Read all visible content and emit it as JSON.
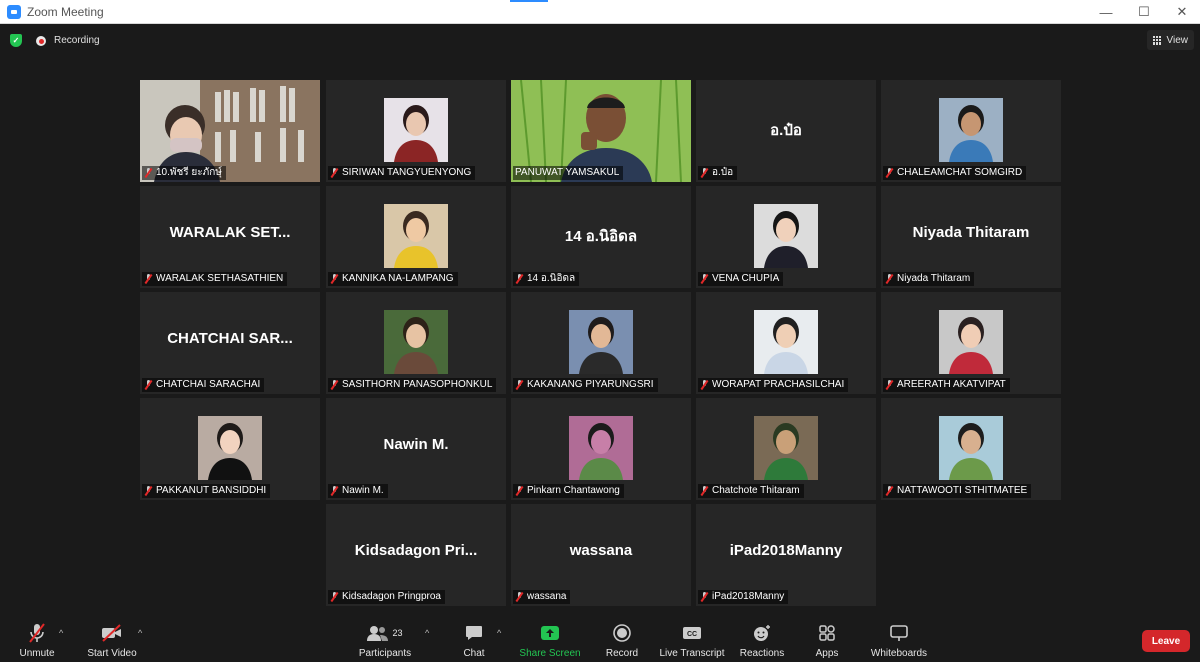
{
  "window": {
    "title": "Zoom Meeting"
  },
  "status": {
    "recording_label": "Recording",
    "view_label": "View"
  },
  "tiles": [
    {
      "label": "10.พัชรี ยะภักษ์ุ",
      "mode": "photo",
      "col": 0,
      "row": 0,
      "speaking": false,
      "scene": "office"
    },
    {
      "label": "SIRIWAN TANGYUENYONG",
      "mode": "avatar",
      "col": 1,
      "row": 0,
      "speaking": false,
      "scene": "portrait-red"
    },
    {
      "label": "PANUWAT YAMSAKUL",
      "mode": "photo",
      "col": 2,
      "row": 0,
      "speaking": true,
      "scene": "field"
    },
    {
      "label": "อ.ป๋อ",
      "mode": "text",
      "display_name": "อ.ป๋อ",
      "col": 3,
      "row": 0,
      "speaking": false
    },
    {
      "label": "CHALEAMCHAT SOMGIRD",
      "mode": "avatar",
      "col": 4,
      "row": 0,
      "speaking": false,
      "scene": "outdoor-sky"
    },
    {
      "label": "WARALAK SETHASATHIEN",
      "mode": "text",
      "display_name": "WARALAK SET...",
      "col": 0,
      "row": 1,
      "speaking": false
    },
    {
      "label": "KANNIKA NA-LAMPANG",
      "mode": "avatar",
      "col": 1,
      "row": 1,
      "speaking": false,
      "scene": "portrait-yellow"
    },
    {
      "label": "14 อ.นิอิดล",
      "mode": "text",
      "display_name": "14 อ.นิอิดล",
      "col": 2,
      "row": 1,
      "speaking": false
    },
    {
      "label": "VENA CHUPIA",
      "mode": "avatar",
      "col": 3,
      "row": 1,
      "speaking": false,
      "scene": "portrait-suit"
    },
    {
      "label": "Niyada Thitaram",
      "mode": "text",
      "display_name": "Niyada Thitaram",
      "col": 4,
      "row": 1,
      "speaking": false
    },
    {
      "label": "CHATCHAI SARACHAI",
      "mode": "text",
      "display_name": "CHATCHAI SAR...",
      "col": 0,
      "row": 2,
      "speaking": false
    },
    {
      "label": "SASITHORN PANASOPHONKUL",
      "mode": "avatar",
      "col": 1,
      "row": 2,
      "speaking": false,
      "scene": "portrait-green"
    },
    {
      "label": "KAKANANG PIYARUNGSRI",
      "mode": "avatar",
      "col": 2,
      "row": 2,
      "speaking": false,
      "scene": "outdoor-sea"
    },
    {
      "label": "WORAPAT PRACHASILCHAI",
      "mode": "avatar",
      "col": 3,
      "row": 2,
      "speaking": false,
      "scene": "portrait-office"
    },
    {
      "label": "AREERATH AKATVIPAT",
      "mode": "avatar",
      "col": 4,
      "row": 2,
      "speaking": false,
      "scene": "portrait-dog"
    },
    {
      "label": "PAKKANUT BANSIDDHI",
      "mode": "avatar",
      "col": 0,
      "row": 3,
      "speaking": false,
      "scene": "portrait-suit-light"
    },
    {
      "label": "Nawin M.",
      "mode": "text",
      "display_name": "Nawin M.",
      "col": 1,
      "row": 3,
      "speaking": false
    },
    {
      "label": "Pinkarn Chantawong",
      "mode": "avatar",
      "col": 2,
      "row": 3,
      "speaking": false,
      "scene": "outdoor-blossom"
    },
    {
      "label": "Chatchote Thitaram",
      "mode": "avatar",
      "col": 3,
      "row": 3,
      "speaking": false,
      "scene": "portrait-animal"
    },
    {
      "label": "NATTAWOOTI STHITMATEE",
      "mode": "avatar",
      "col": 4,
      "row": 3,
      "speaking": false,
      "scene": "outdoor-trees"
    },
    {
      "label": "Kidsadagon Pringproa",
      "mode": "text",
      "display_name": "Kidsadagon Pri...",
      "col": 1,
      "row": 4,
      "speaking": false
    },
    {
      "label": "wassana",
      "mode": "text",
      "display_name": "wassana",
      "col": 2,
      "row": 4,
      "speaking": false
    },
    {
      "label": "iPad2018Manny",
      "mode": "text",
      "display_name": "iPad2018Manny",
      "col": 3,
      "row": 4,
      "speaking": false
    }
  ],
  "toolbar": {
    "unmute": "Unmute",
    "start_video": "Start Video",
    "participants": "Participants",
    "participants_count": "23",
    "chat": "Chat",
    "share_screen": "Share Screen",
    "record": "Record",
    "live_transcript": "Live Transcript",
    "reactions": "Reactions",
    "apps": "Apps",
    "whiteboards": "Whiteboards",
    "leave": "Leave",
    "cc_label": "CC"
  },
  "colors": {
    "speaking_outline": "#e4e86b",
    "share_green": "#23c552",
    "leave_red": "#d4272b",
    "tile_bg": "#262626"
  }
}
